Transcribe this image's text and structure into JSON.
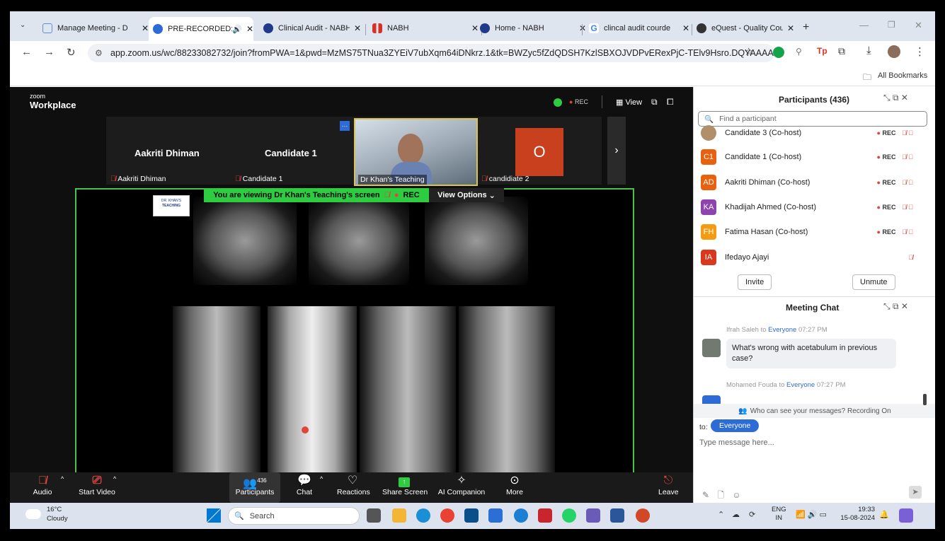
{
  "browser": {
    "tabs": [
      {
        "label": "Manage Meeting - D",
        "color": "#5b8fd6"
      },
      {
        "label": "PRE-RECORDED:",
        "color": "#2d6bd7"
      },
      {
        "label": "Clinical Audit - NABH",
        "color": "#1f3a8a"
      },
      {
        "label": "NABH",
        "color": "#d93025"
      },
      {
        "label": "Home - NABH",
        "color": "#1f3a8a"
      },
      {
        "label": "clincal audit courde",
        "color": "#4285f4"
      },
      {
        "label": "eQuest - Quality Cou",
        "color": "#333333"
      }
    ],
    "url": "app.zoom.us/wc/88233082732/join?fromPWA=1&pwd=MzMS75TNua3ZYEiV7ubXqm64iDNkrz.1&tk=BWZyc5fZdQDSH7KzlSBXOJVDPvERexPjC-TElv9Hsro.DQYAAAAUix...",
    "bookmarks": "All Bookmarks"
  },
  "zoom": {
    "brand_top": "zoom",
    "brand": "Workplace",
    "rec": "REC",
    "view": "View",
    "tiles": [
      {
        "name": "Aakriti Dhiman",
        "label": "Aakriti Dhiman"
      },
      {
        "name": "Candidate 1",
        "label": "Candidate 1"
      },
      {
        "name": "",
        "label": "Dr Khan's Teaching"
      },
      {
        "name": "O",
        "label": "candidiate 2"
      }
    ],
    "viewing_text": "You are viewing  Dr Khan's Teaching's screen",
    "viewing_rec": "REC",
    "view_options": "View Options",
    "controls": {
      "audio": "Audio",
      "start_video": "Start Video",
      "participants": "Participants",
      "participant_count": "436",
      "chat": "Chat",
      "reactions": "Reactions",
      "share": "Share Screen",
      "ai": "AI Companion",
      "more": "More",
      "leave": "Leave"
    },
    "logo_line1": "DR. KHAN'S",
    "logo_line2": "TEACHING"
  },
  "sidebar": {
    "participants_title": "Participants (436)",
    "search_placeholder": "Find a participant",
    "participants": [
      {
        "initials": "",
        "name": "Candidate 3 (Co-host)",
        "color": "#b08f6a",
        "rec": true
      },
      {
        "initials": "C1",
        "name": "Candidate 1 (Co-host)",
        "color": "#e8610f",
        "rec": true
      },
      {
        "initials": "AD",
        "name": "Aakriti Dhiman (Co-host)",
        "color": "#e8610f",
        "rec": true
      },
      {
        "initials": "KA",
        "name": "Khadijah Ahmed (Co-host)",
        "color": "#8e44ad",
        "rec": true
      },
      {
        "initials": "FH",
        "name": "Fatima Hasan (Co-host)",
        "color": "#f39c12",
        "rec": true
      },
      {
        "initials": "IA",
        "name": "Ifedayo Ajayi",
        "color": "#d9381e",
        "rec": false
      }
    ],
    "rec_label": "REC",
    "invite": "Invite",
    "unmute": "Unmute",
    "chat_title": "Meeting Chat",
    "messages": [
      {
        "sender": "Ifrah Saleh",
        "to_word": "to",
        "to": "Everyone",
        "time": "07:27 PM",
        "text": "What's wrong with acetabulum in previous case?"
      },
      {
        "sender": "Mohamed Fouda",
        "to_word": "to",
        "to": "Everyone",
        "time": "07:27 PM",
        "text": ""
      }
    ],
    "who_can_see": "Who can see your messages? Recording On",
    "to_label": "to:",
    "recipient": "Everyone",
    "input_placeholder": "Type message here..."
  },
  "taskbar": {
    "temp": "16°C",
    "weather": "Cloudy",
    "search": "Search",
    "lang1": "ENG",
    "lang2": "IN",
    "time": "19:33",
    "date": "15-08-2024"
  }
}
